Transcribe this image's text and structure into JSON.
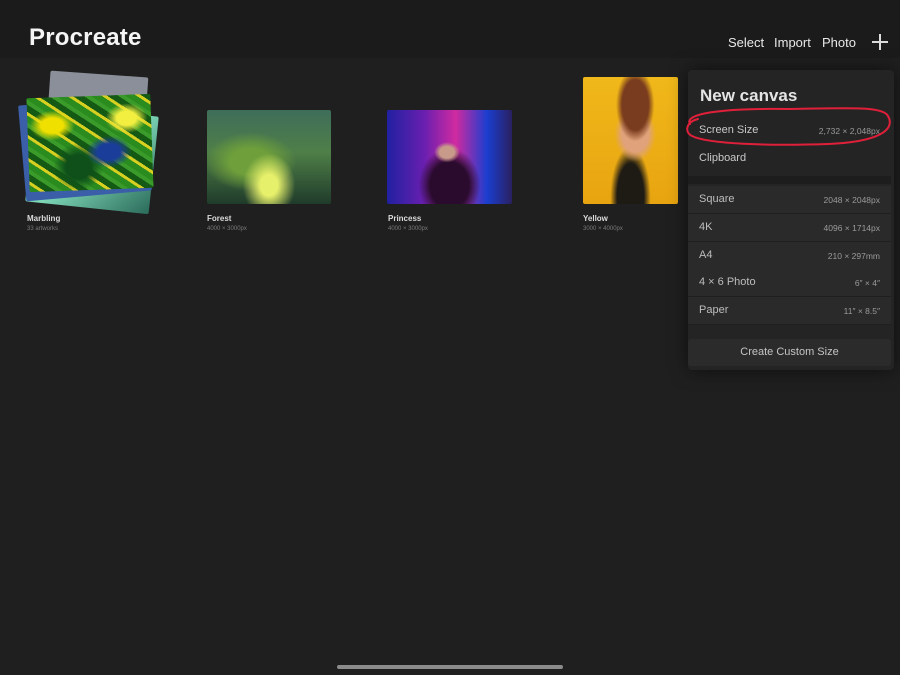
{
  "header": {
    "app_title": "Procreate",
    "select_label": "Select",
    "import_label": "Import",
    "photo_label": "Photo",
    "add_icon": "plus-icon"
  },
  "gallery": [
    {
      "title": "Marbling",
      "subtitle": "33 artworks"
    },
    {
      "title": "Forest",
      "subtitle": "4000 × 3000px"
    },
    {
      "title": "Princess",
      "subtitle": "4000 × 3000px"
    },
    {
      "title": "Yellow",
      "subtitle": "3000 × 4000px"
    }
  ],
  "new_canvas": {
    "title": "New canvas",
    "top_rows": [
      {
        "name": "Screen Size",
        "dim": "2,732 × 2,048px"
      },
      {
        "name": "Clipboard",
        "dim": ""
      }
    ],
    "presets": [
      {
        "name": "Square",
        "dim": "2048 × 2048px"
      },
      {
        "name": "4K",
        "dim": "4096 × 1714px"
      },
      {
        "name": "A4",
        "dim": "210 × 297mm"
      },
      {
        "name": "4 × 6 Photo",
        "dim": "6″ × 4″"
      },
      {
        "name": "Paper",
        "dim": "11″ × 8.5″"
      }
    ],
    "custom_label": "Create Custom Size"
  },
  "colors": {
    "background": "#1f1f1f",
    "annotation": "#e0203a"
  }
}
